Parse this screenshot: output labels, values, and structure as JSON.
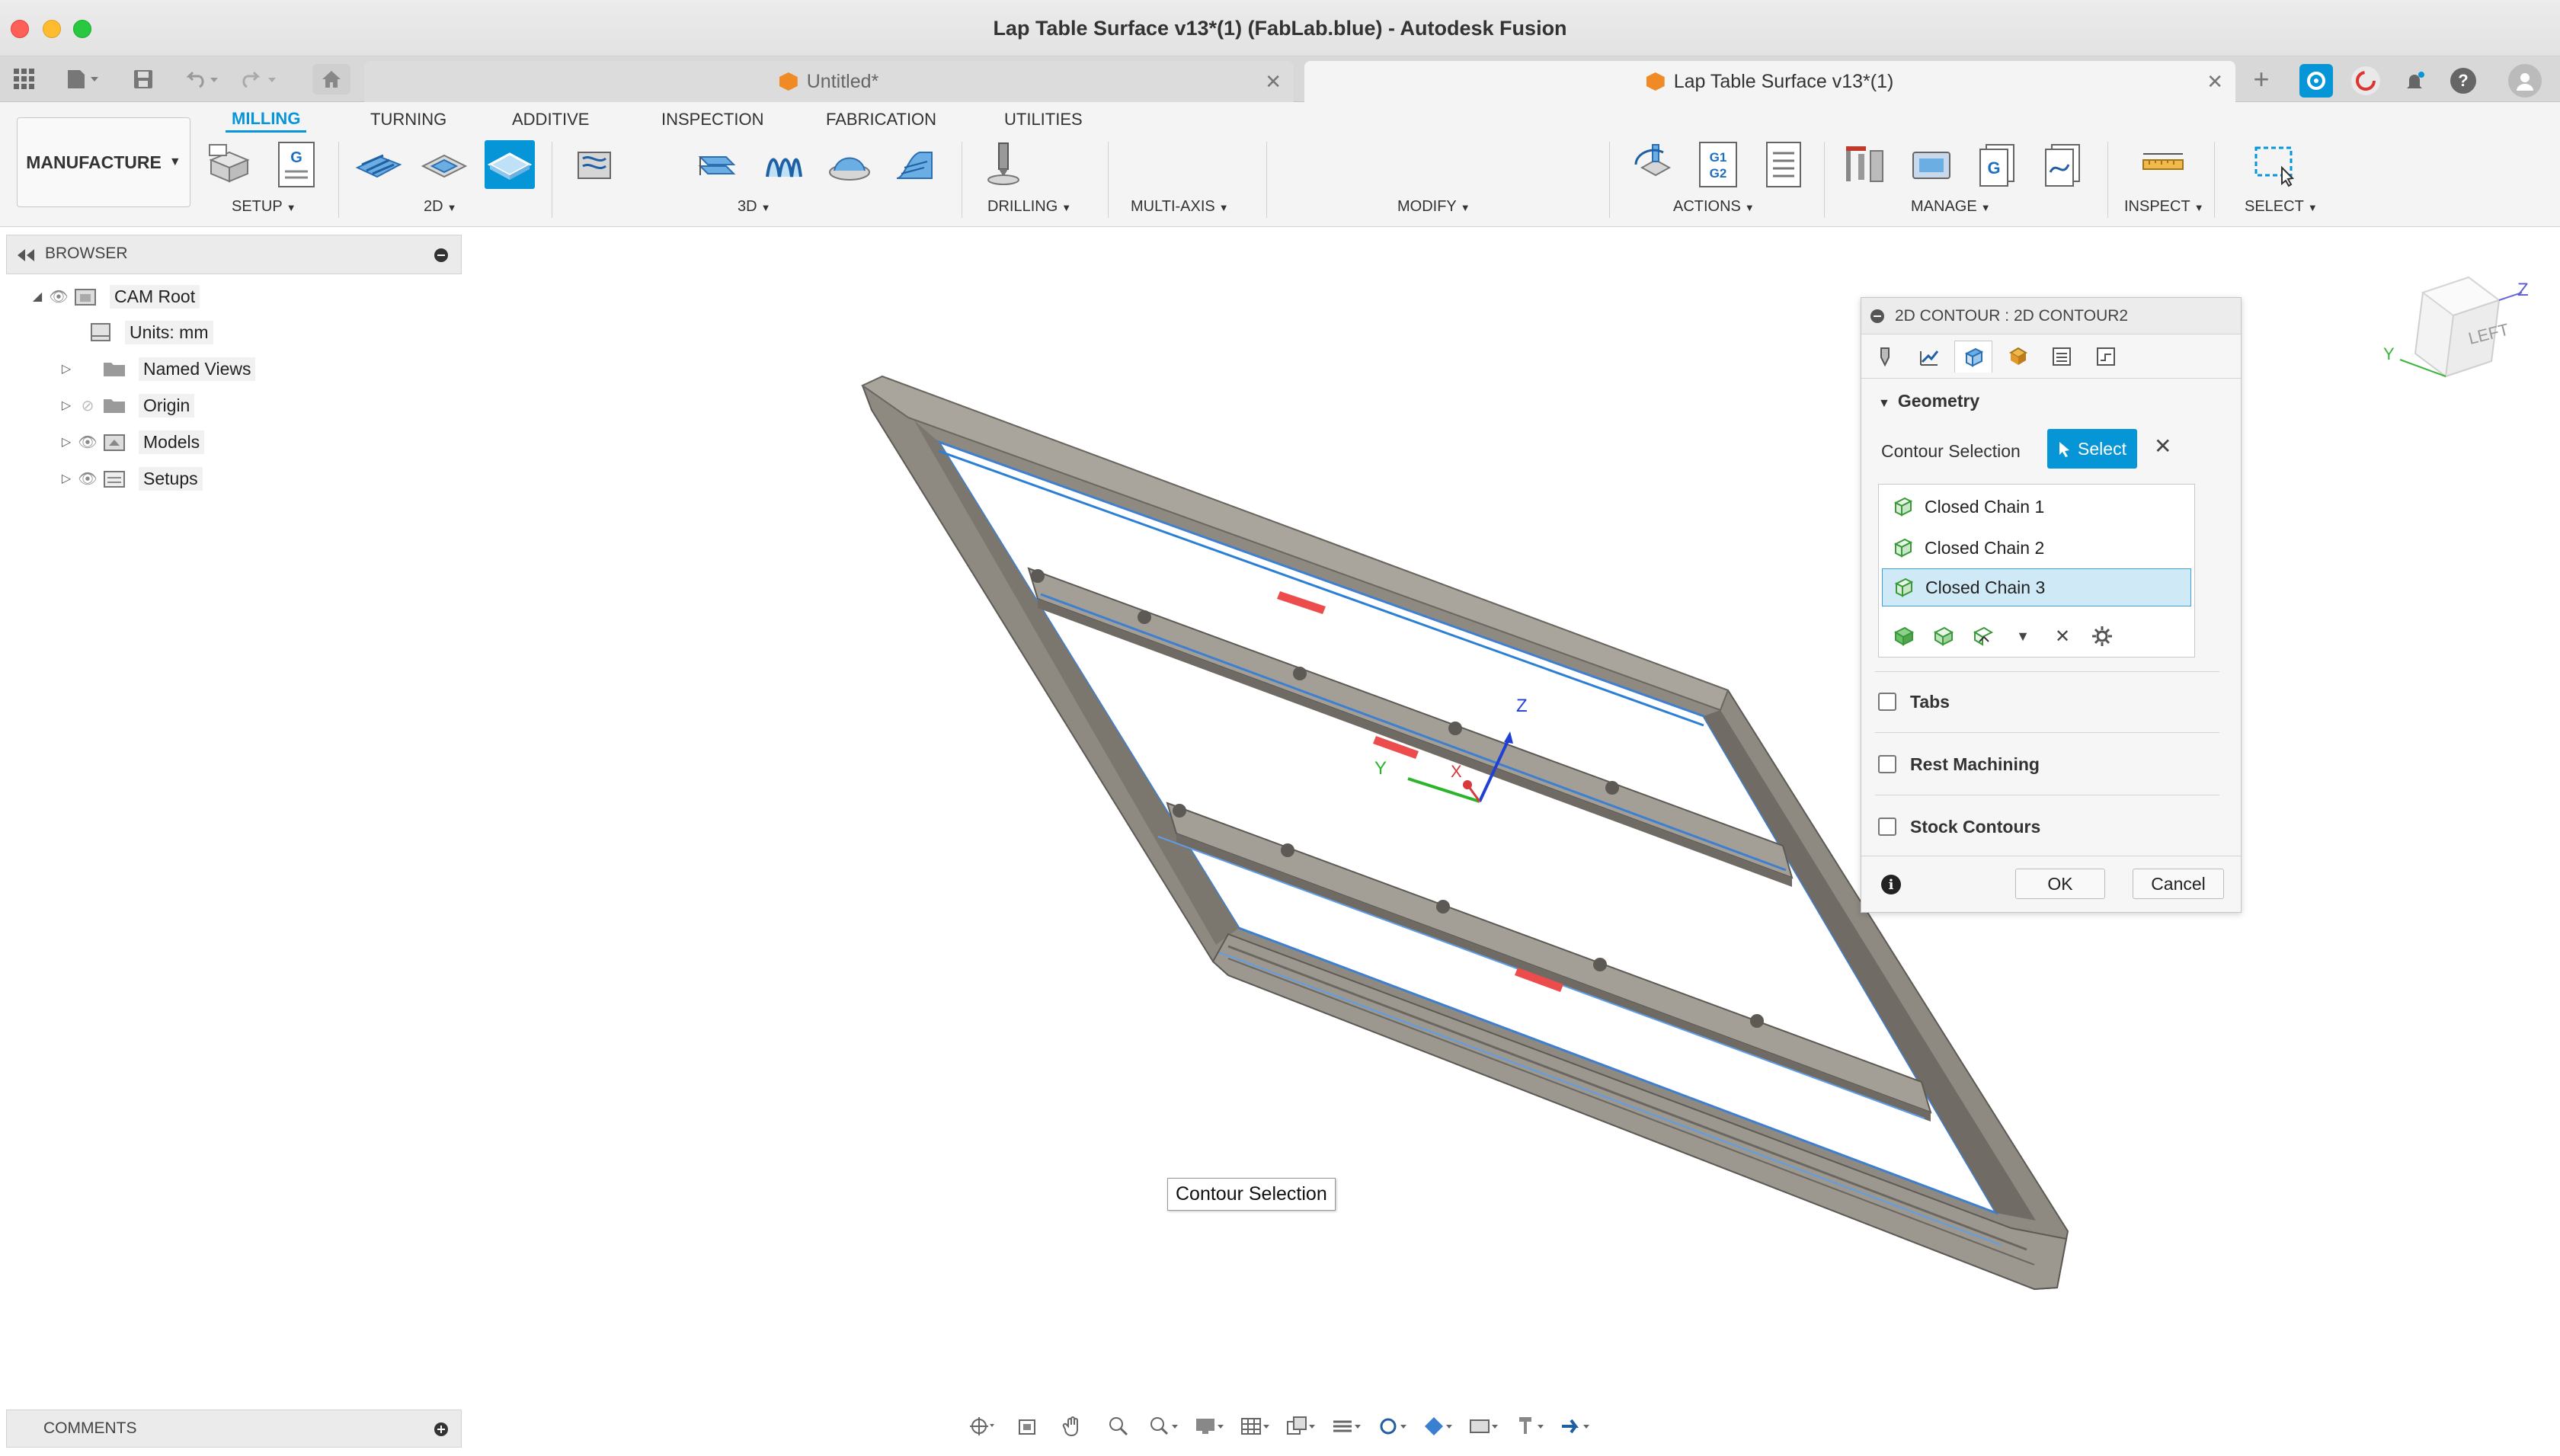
{
  "window": {
    "title": "Lap Table Surface v13*(1) (FabLab.blue) - Autodesk Fusion"
  },
  "tabs": [
    {
      "label": "Untitled*"
    },
    {
      "label": "Lap Table Surface v13*(1)"
    }
  ],
  "workspace": {
    "label": "MANUFACTURE"
  },
  "ribbon": {
    "tabs": [
      "MILLING",
      "TURNING",
      "ADDITIVE",
      "INSPECTION",
      "FABRICATION",
      "UTILITIES"
    ],
    "groups": {
      "setup": "SETUP",
      "twod": "2D",
      "threed": "3D",
      "drilling": "DRILLING",
      "multiaxis": "MULTI-AXIS",
      "modify": "MODIFY",
      "actions": "ACTIONS",
      "manage": "MANAGE",
      "inspect": "INSPECT",
      "select": "SELECT"
    },
    "g1g2_text": "G1\nG2",
    "g_text": "G"
  },
  "browser": {
    "title": "BROWSER",
    "items": [
      {
        "label": "CAM Root"
      },
      {
        "label": "Units: mm"
      },
      {
        "label": "Named Views"
      },
      {
        "label": "Origin"
      },
      {
        "label": "Models"
      },
      {
        "label": "Setups"
      }
    ]
  },
  "comments": {
    "title": "COMMENTS"
  },
  "viewport": {
    "tooltip": "Contour Selection",
    "axis_labels": {
      "x": "X",
      "y": "Y",
      "z": "Z"
    },
    "viewcube": {
      "face": "LEFT",
      "z": "Z",
      "y": "Y"
    }
  },
  "dialog": {
    "title": "2D CONTOUR : 2D CONTOUR2",
    "section": "Geometry",
    "contour_label": "Contour Selection",
    "select_button": "Select",
    "chains": [
      "Closed Chain 1",
      "Closed Chain 2",
      "Closed Chain 3"
    ],
    "selected_chain": "Closed Chain 3",
    "options": [
      "Tabs",
      "Rest Machining",
      "Stock Contours"
    ],
    "ok": "OK",
    "cancel": "Cancel"
  },
  "colors": {
    "accent": "#0696d7",
    "frame": "#8a857c",
    "selection": "#2b7fd4"
  }
}
